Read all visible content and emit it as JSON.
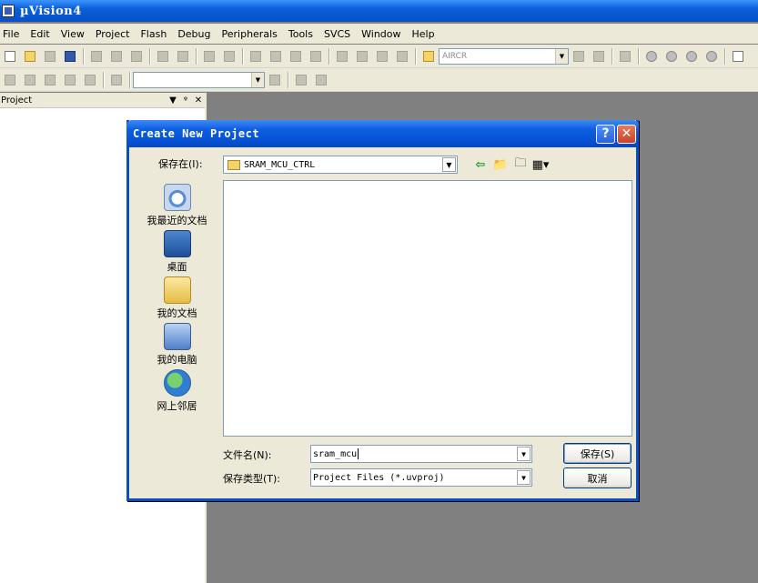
{
  "window": {
    "title": "µVision4"
  },
  "menubar": {
    "items": [
      "File",
      "Edit",
      "View",
      "Project",
      "Flash",
      "Debug",
      "Peripherals",
      "Tools",
      "SVCS",
      "Window",
      "Help"
    ]
  },
  "toolbar": {
    "target_combo": "AIRCR",
    "build_combo": ""
  },
  "project_panel": {
    "title": "Project"
  },
  "dialog": {
    "title": "Create New Project",
    "help_glyph": "?",
    "close_glyph": "✕",
    "save_in_label": "保存在(I):",
    "save_in_value": "SRAM_MCU_CTRL",
    "places": [
      {
        "label": "我最近的文档",
        "icon": "recent-documents-icon"
      },
      {
        "label": "桌面",
        "icon": "desktop-icon"
      },
      {
        "label": "我的文档",
        "icon": "my-documents-icon"
      },
      {
        "label": "我的电脑",
        "icon": "my-computer-icon"
      },
      {
        "label": "网上邻居",
        "icon": "network-places-icon"
      }
    ],
    "file_name_label": "文件名(N):",
    "file_name_value": "sram_mcu",
    "file_type_label": "保存类型(T):",
    "file_type_value": "Project Files (*.uvproj)",
    "save_button": "保存(S)",
    "cancel_button": "取消"
  }
}
